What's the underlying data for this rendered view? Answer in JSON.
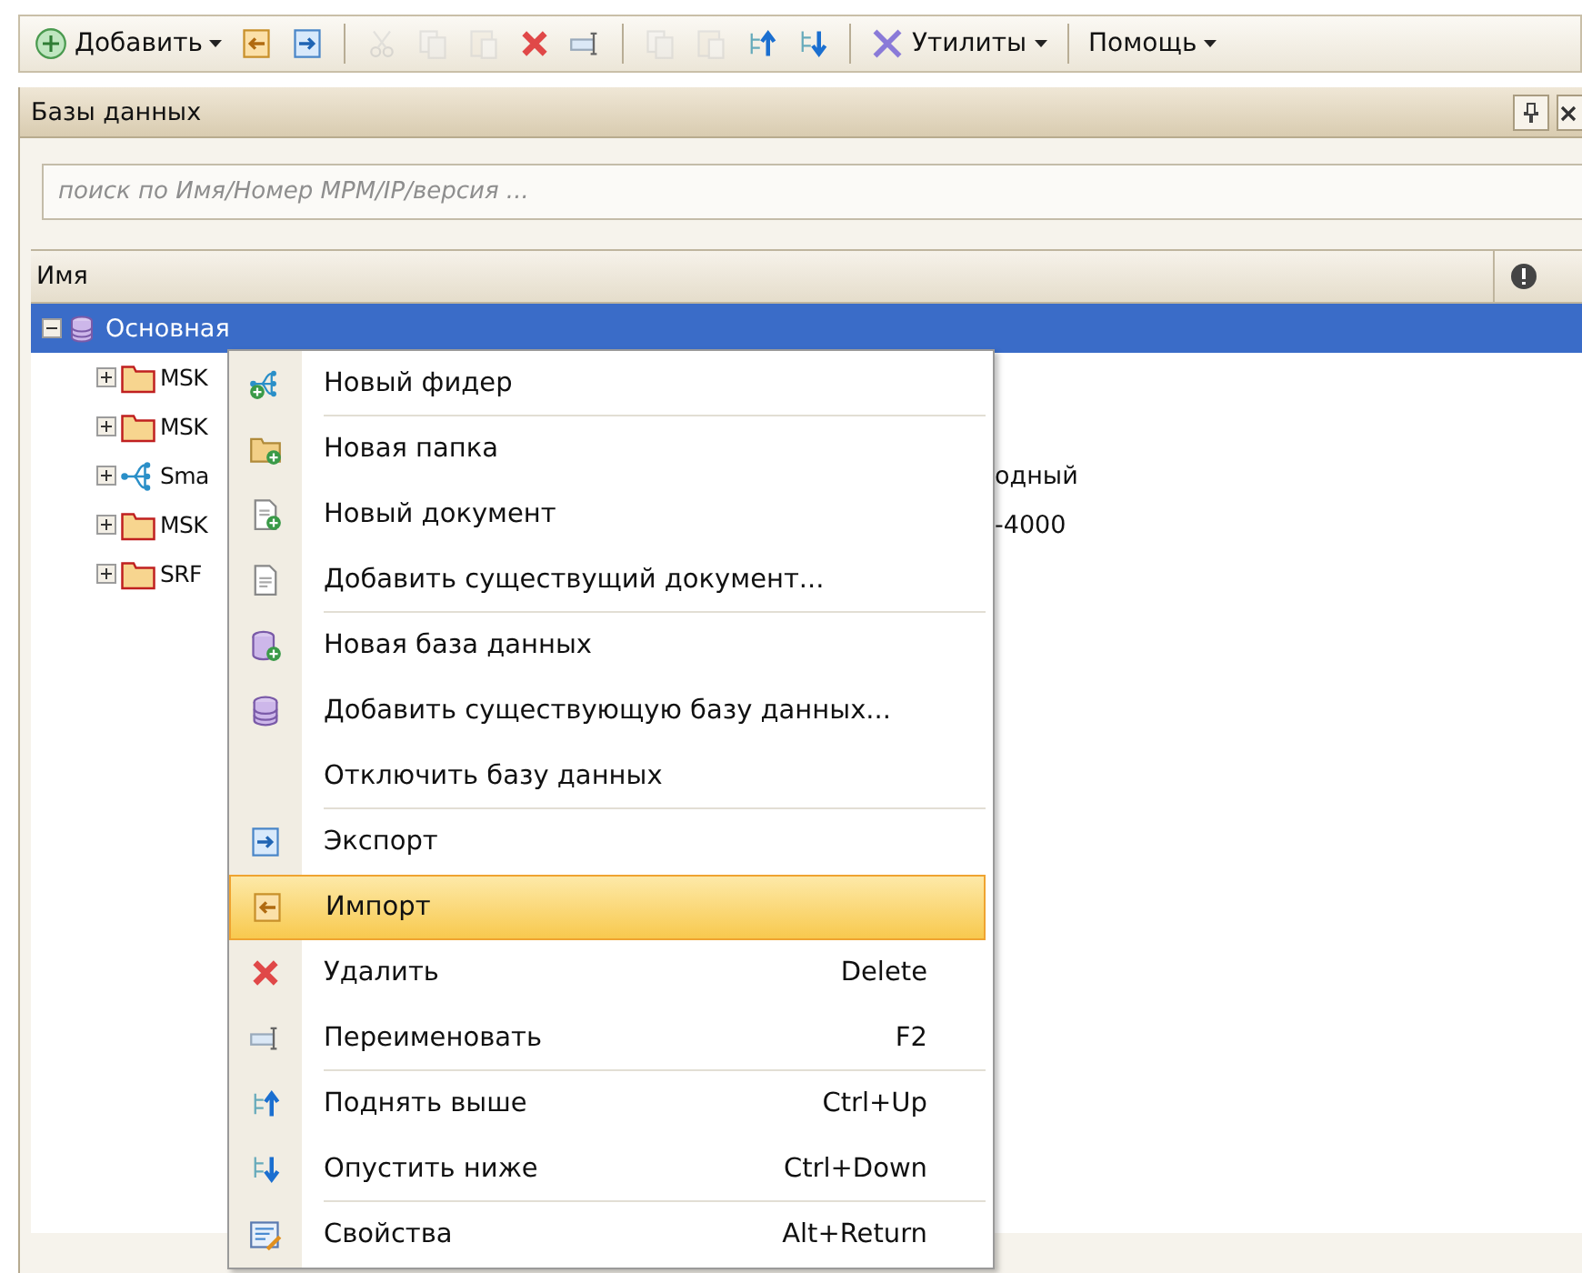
{
  "toolbar": [
    {
      "kind": "add",
      "label": "Добавить",
      "dropdown": true,
      "disabled": false
    },
    {
      "kind": "import",
      "disabled": false
    },
    {
      "kind": "export",
      "disabled": false
    },
    {
      "kind": "separator"
    },
    {
      "kind": "cut",
      "disabled": true
    },
    {
      "kind": "copy",
      "disabled": true
    },
    {
      "kind": "paste",
      "disabled": true
    },
    {
      "kind": "delete",
      "disabled": false
    },
    {
      "kind": "rename",
      "disabled": false
    },
    {
      "kind": "separator"
    },
    {
      "kind": "copy",
      "disabled": true
    },
    {
      "kind": "paste",
      "disabled": true
    },
    {
      "kind": "up",
      "disabled": false
    },
    {
      "kind": "down",
      "disabled": false
    },
    {
      "kind": "separator"
    },
    {
      "kind": "tools",
      "label": "Утилиты",
      "dropdown": true,
      "disabled": false
    },
    {
      "kind": "separator"
    },
    {
      "kind": "none",
      "label": "Помощь",
      "dropdown": true,
      "disabled": false
    }
  ],
  "panel": {
    "title": "Базы данных",
    "search": {
      "placeholder": "поиск по Имя/Номер МРМ/IP/версия ..."
    },
    "columns": [
      "Имя"
    ],
    "tree": [
      {
        "kind": "database",
        "label": "Основная",
        "selected": true,
        "expanded": true,
        "children": [
          {
            "kind": "folder",
            "label": "MSK",
            "expanded": false
          },
          {
            "kind": "folder",
            "label": "MSK",
            "expanded": false
          },
          {
            "kind": "feeder",
            "label": "Sma",
            "expanded": false,
            "column_2": "одный"
          },
          {
            "kind": "folder",
            "label": "MSK",
            "expanded": false,
            "column_2": "-4000"
          },
          {
            "kind": "folder",
            "label": "SRF",
            "expanded": false
          }
        ]
      }
    ]
  },
  "context_menu": {
    "sections": [
      [
        {
          "kind": "feeder",
          "label": "Новый фидер",
          "selected": false
        }
      ],
      [
        {
          "kind": "folder",
          "label": "Новая папка",
          "selected": false
        },
        {
          "kind": "newdoc",
          "label": "Новый документ",
          "selected": false
        },
        {
          "kind": "doc",
          "label": "Добавить существущий документ...",
          "selected": false
        }
      ],
      [
        {
          "kind": "newdb",
          "label": "Новая база данных",
          "selected": false
        },
        {
          "kind": "database",
          "label": "Добавить существующую базу данных...",
          "selected": false
        },
        {
          "kind": "none",
          "label": "Отключить базу данных",
          "selected": false
        }
      ],
      [
        {
          "kind": "export",
          "label": "Экспорт",
          "selected": false
        },
        {
          "kind": "import",
          "label": "Импорт",
          "selected": true
        }
      ],
      [
        {
          "kind": "delete",
          "label": "Удалить",
          "shortcut": "Delete",
          "selected": false
        },
        {
          "kind": "rename",
          "label": "Переименовать",
          "shortcut": "F2",
          "selected": false
        }
      ],
      [
        {
          "kind": "up",
          "label": "Поднять выше",
          "shortcut": "Ctrl+Up",
          "selected": false
        },
        {
          "kind": "down",
          "label": "Опустить ниже",
          "shortcut": "Ctrl+Down",
          "selected": false
        }
      ],
      [
        {
          "kind": "props",
          "label": "Свойства",
          "shortcut": "Alt+Return",
          "selected": false
        }
      ]
    ]
  }
}
